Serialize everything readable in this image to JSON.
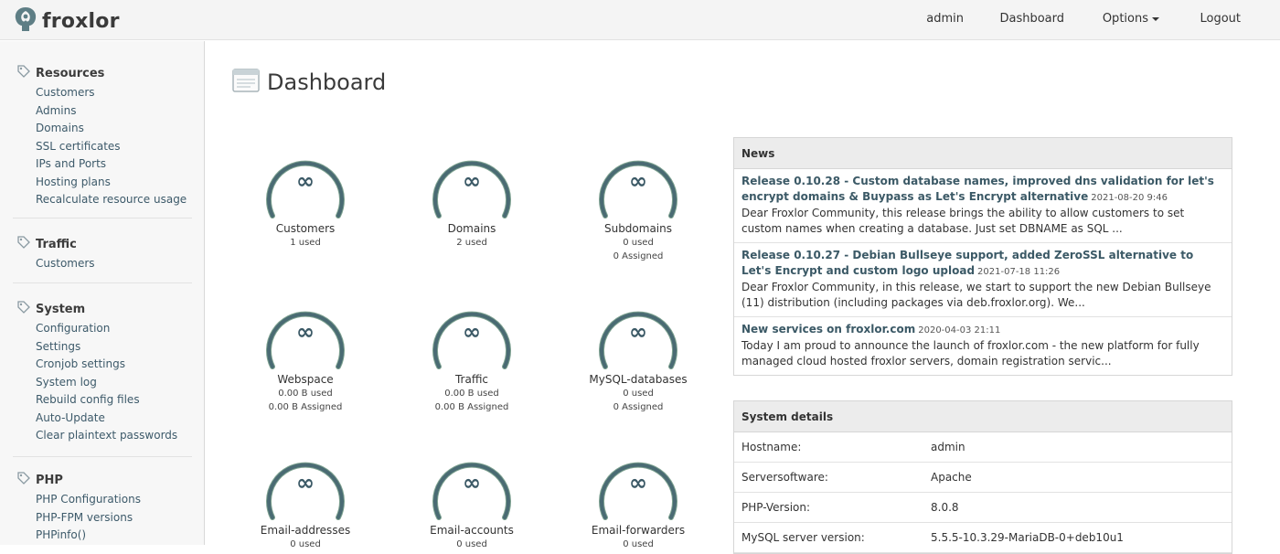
{
  "brand": {
    "name": "froxlor"
  },
  "topnav": {
    "admin": "admin",
    "dashboard": "Dashboard",
    "options": "Options",
    "logout": "Logout"
  },
  "sidebar": {
    "resources": {
      "title": "Resources",
      "items": [
        "Customers",
        "Admins",
        "Domains",
        "SSL certificates",
        "IPs and Ports",
        "Hosting plans",
        "Recalculate resource usage"
      ]
    },
    "traffic": {
      "title": "Traffic",
      "items": [
        "Customers"
      ]
    },
    "system": {
      "title": "System",
      "items": [
        "Configuration",
        "Settings",
        "Cronjob settings",
        "System log",
        "Rebuild config files",
        "Auto-Update",
        "Clear plaintext passwords"
      ]
    },
    "php": {
      "title": "PHP",
      "items": [
        "PHP Configurations",
        "PHP-FPM versions",
        "PHPinfo()"
      ]
    }
  },
  "page_title": "Dashboard",
  "gauges": [
    {
      "symbol": "∞",
      "label": "Customers",
      "used": "1 used",
      "assigned": ""
    },
    {
      "symbol": "∞",
      "label": "Domains",
      "used": "2 used",
      "assigned": ""
    },
    {
      "symbol": "∞",
      "label": "Subdomains",
      "used": "0 used",
      "assigned": "0 Assigned"
    },
    {
      "symbol": "∞",
      "label": "Webspace",
      "used": "0.00 B used",
      "assigned": "0.00 B Assigned"
    },
    {
      "symbol": "∞",
      "label": "Traffic",
      "used": "0.00 B used",
      "assigned": "0.00 B Assigned"
    },
    {
      "symbol": "∞",
      "label": "MySQL-databases",
      "used": "0 used",
      "assigned": "0 Assigned"
    },
    {
      "symbol": "∞",
      "label": "Email-addresses",
      "used": "0 used",
      "assigned": ""
    },
    {
      "symbol": "∞",
      "label": "Email-accounts",
      "used": "0 used",
      "assigned": ""
    },
    {
      "symbol": "∞",
      "label": "Email-forwarders",
      "used": "0 used",
      "assigned": ""
    }
  ],
  "news": {
    "title": "News",
    "items": [
      {
        "title": "Release 0.10.28 - Custom database names, improved dns validation for let's encrypt domains & Buypass as Let's Encrypt alternative",
        "date": "2021-08-20 9:46",
        "body": "Dear Froxlor Community, this release brings the ability to allow customers to set custom names when creating a database. Just set DBNAME as SQL ..."
      },
      {
        "title": "Release 0.10.27 - Debian Bullseye support, added ZeroSSL alternative to Let's Encrypt and custom logo upload",
        "date": "2021-07-18 11:26",
        "body": "Dear Froxlor Community, in this release, we start to support the new Debian Bullseye (11) distribution (including packages via deb.froxlor.org). We..."
      },
      {
        "title": "New services on froxlor.com",
        "date": "2020-04-03 21:11",
        "body": "Today I am proud to announce the launch of froxlor.com - the new platform for fully managed cloud hosted froxlor servers, domain registration servic..."
      }
    ]
  },
  "system_details": {
    "title": "System details",
    "rows": [
      {
        "label": "Hostname:",
        "value": "admin"
      },
      {
        "label": "Serversoftware:",
        "value": "Apache"
      },
      {
        "label": "PHP-Version:",
        "value": "8.0.8"
      },
      {
        "label": "MySQL server version:",
        "value": "5.5.5-10.3.29-MariaDB-0+deb10u1"
      }
    ]
  },
  "colors": {
    "gauge_ring": "#4a6b73",
    "gauge_ring_light": "#7fa391",
    "link": "#3d5a6a",
    "news_title": "#3b5966"
  }
}
